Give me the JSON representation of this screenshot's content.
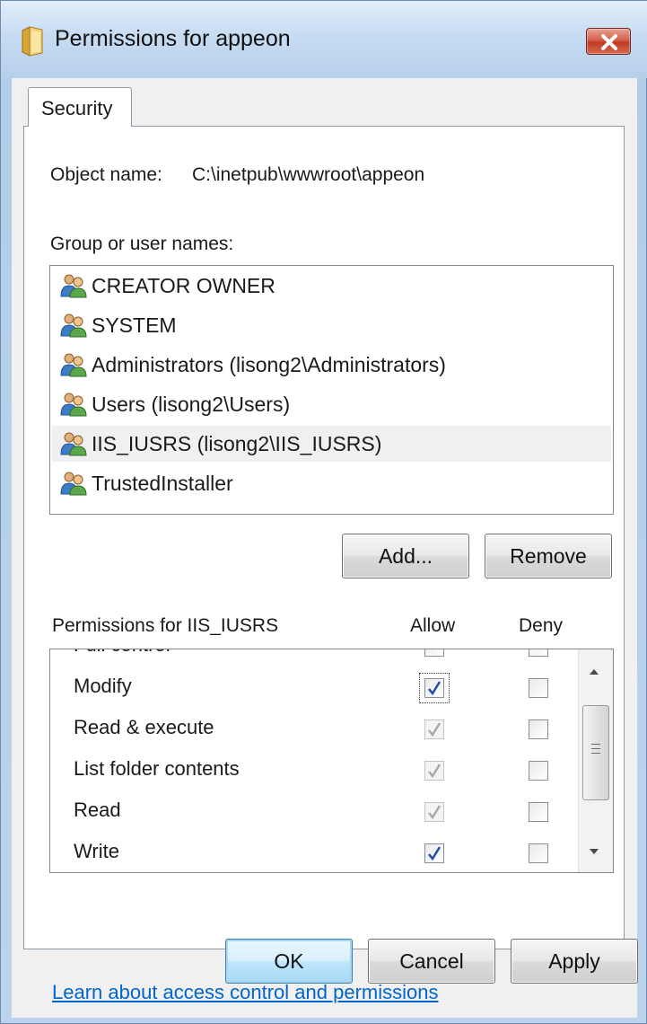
{
  "window": {
    "title": "Permissions for appeon",
    "close_icon": "close-icon"
  },
  "tabs": [
    {
      "label": "Security",
      "active": true
    }
  ],
  "object_name": {
    "label": "Object name:",
    "value": "C:\\inetpub\\wwwroot\\appeon"
  },
  "group_list": {
    "label": "Group or user names:",
    "items": [
      {
        "label": "CREATOR OWNER",
        "icon": "users-icon",
        "selected": false
      },
      {
        "label": "SYSTEM",
        "icon": "users-icon",
        "selected": false
      },
      {
        "label": "Administrators (lisong2\\Administrators)",
        "icon": "users-icon",
        "selected": false
      },
      {
        "label": "Users (lisong2\\Users)",
        "icon": "users-icon",
        "selected": false
      },
      {
        "label": "IIS_IUSRS (lisong2\\IIS_IUSRS)",
        "icon": "users-icon",
        "selected": true
      },
      {
        "label": "TrustedInstaller",
        "icon": "users-icon",
        "selected": false
      }
    ]
  },
  "buttons": {
    "add": "Add...",
    "remove": "Remove",
    "ok": "OK",
    "cancel": "Cancel",
    "apply": "Apply"
  },
  "permissions": {
    "header": "Permissions for IIS_IUSRS",
    "allow_header": "Allow",
    "deny_header": "Deny",
    "rows": [
      {
        "label": "Full control",
        "allow": false,
        "allow_disabled": false,
        "deny": false
      },
      {
        "label": "Modify",
        "allow": true,
        "allow_disabled": false,
        "deny": false,
        "focused": true
      },
      {
        "label": "Read & execute",
        "allow": true,
        "allow_disabled": true,
        "deny": false
      },
      {
        "label": "List folder contents",
        "allow": true,
        "allow_disabled": true,
        "deny": false
      },
      {
        "label": "Read",
        "allow": true,
        "allow_disabled": true,
        "deny": false
      },
      {
        "label": "Write",
        "allow": true,
        "allow_disabled": false,
        "deny": false
      }
    ]
  },
  "help_link": "Learn about access control and permissions",
  "colors": {
    "link": "#0066cc",
    "checkmark": "#1f4fa8",
    "checkmark_disabled": "#a9a9a9"
  }
}
